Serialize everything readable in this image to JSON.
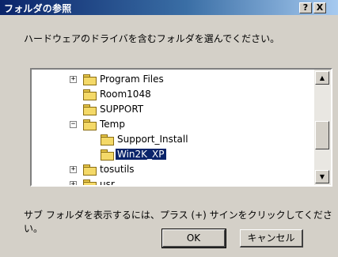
{
  "window": {
    "title": "フォルダの参照",
    "help_label": "?",
    "close_label": "X"
  },
  "instruction": "ハードウェアのドライバを含むフォルダを選んでください。",
  "tree": {
    "items": [
      {
        "label": "Program Files",
        "expander": "+",
        "selected": false
      },
      {
        "label": "Room1048",
        "expander": "",
        "selected": false
      },
      {
        "label": "SUPPORT",
        "expander": "",
        "selected": false
      },
      {
        "label": "Temp",
        "expander": "−",
        "selected": false
      },
      {
        "label": "Support_Install",
        "expander": "",
        "selected": false
      },
      {
        "label": "Win2K_XP",
        "expander": "",
        "selected": true
      },
      {
        "label": "tosutils",
        "expander": "+",
        "selected": false
      },
      {
        "label": "usr",
        "expander": "+",
        "selected": false
      }
    ],
    "scroll_up_glyph": "▲",
    "scroll_down_glyph": "▼"
  },
  "hint": "サブ フォルダを表示するには、プラス (+) サインをクリックしてください。",
  "buttons": {
    "ok": "OK",
    "cancel": "キャンセル"
  }
}
